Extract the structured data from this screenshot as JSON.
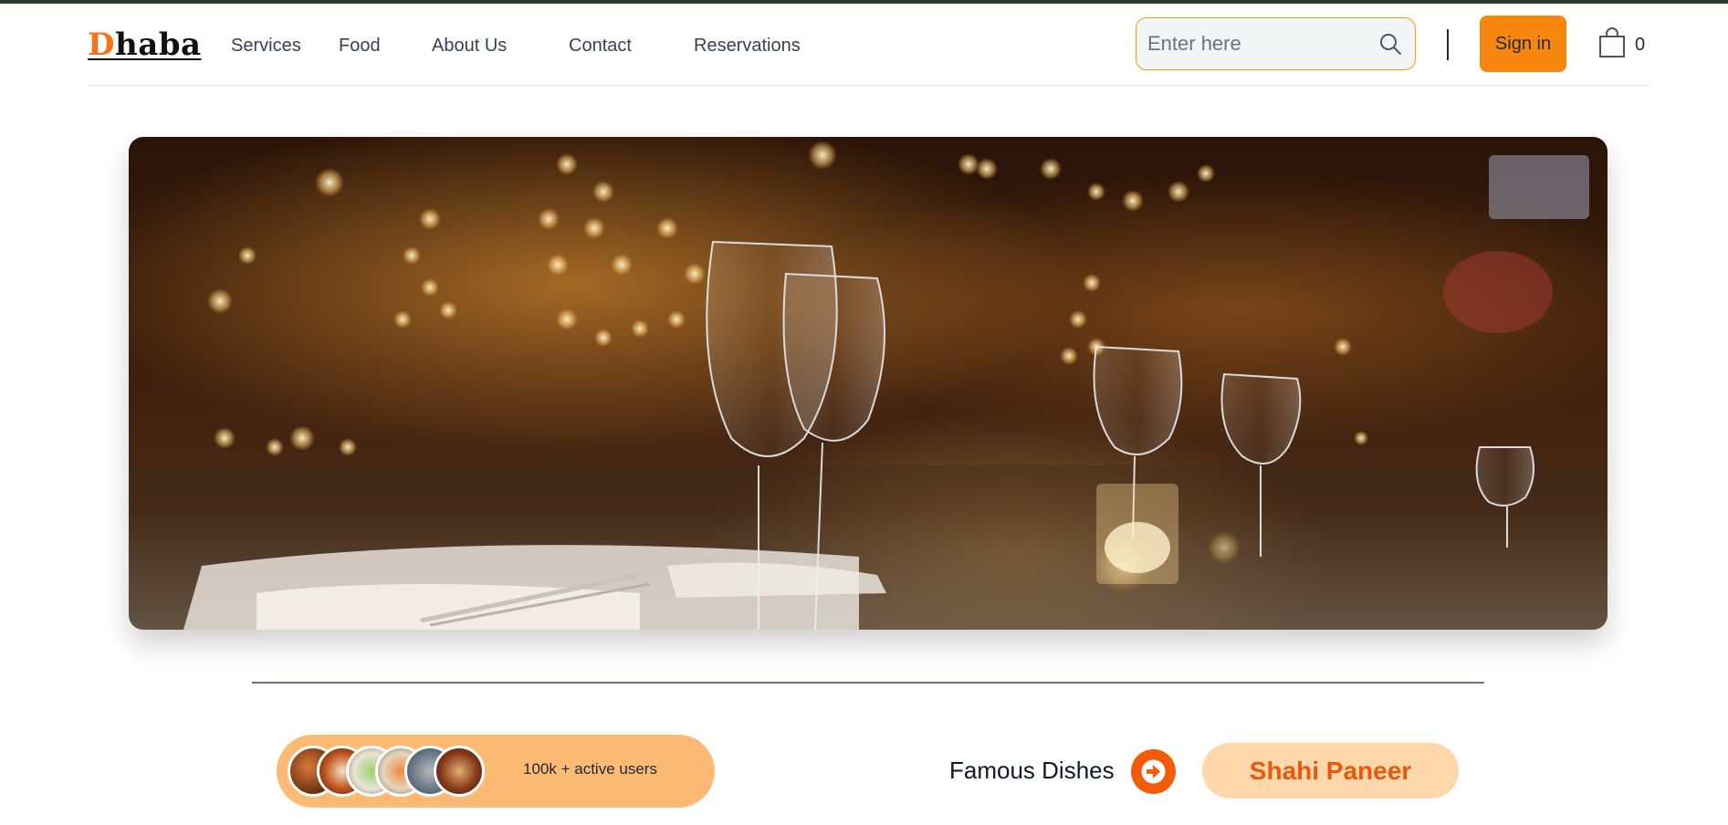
{
  "brand": {
    "first_letter": "D",
    "rest": "haba"
  },
  "nav": [
    "Services",
    "Food",
    "About Us",
    "Contact",
    "Reservations"
  ],
  "search": {
    "placeholder": "Enter here",
    "value": ""
  },
  "header": {
    "signin_label": "Sign in",
    "cart_count": "0"
  },
  "community": {
    "users_text": "100k + active users",
    "avatars": [
      "food-avatar-1",
      "food-avatar-2",
      "food-avatar-3",
      "food-avatar-4",
      "food-avatar-5",
      "food-avatar-6"
    ]
  },
  "famous": {
    "label": "Famous Dishes",
    "dish": "Shahi Paneer"
  },
  "colors": {
    "accent": "#f7870f",
    "pill": "#fdba74",
    "dish_pill": "#fed7aa",
    "dish_text": "#ea580c",
    "arrow": "#f35b08"
  }
}
